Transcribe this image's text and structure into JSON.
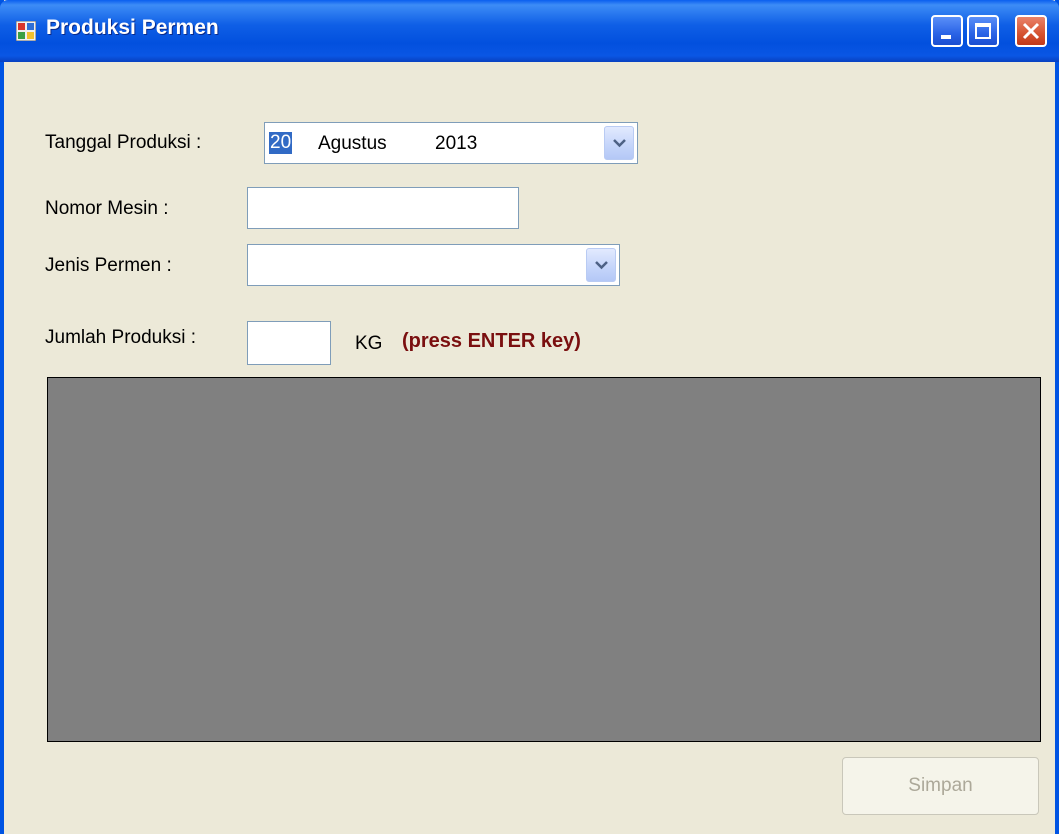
{
  "window": {
    "title": "Produksi Permen",
    "controls": {
      "minimize": "minimize-icon",
      "maximize": "maximize-icon",
      "close": "close-icon"
    }
  },
  "form": {
    "tanggal_label": "Tanggal Produksi :",
    "tanggal": {
      "day": "20",
      "month": "Agustus",
      "year": "2013"
    },
    "nomor_label": "Nomor Mesin :",
    "nomor_value": "",
    "jenis_label": "Jenis Permen :",
    "jenis_value": "",
    "jumlah_label": "Jumlah Produksi :",
    "jumlah_value": "",
    "unit": "KG",
    "hint": "(press ENTER key)"
  },
  "actions": {
    "save_label": "Simpan"
  },
  "colors": {
    "titlebar": "#0054E3",
    "window_bg": "#ECE9D8",
    "grid_bg": "#808080",
    "hint": "#7A0F0F",
    "disabled_text": "#ACA899",
    "selection": "#316AC5"
  }
}
